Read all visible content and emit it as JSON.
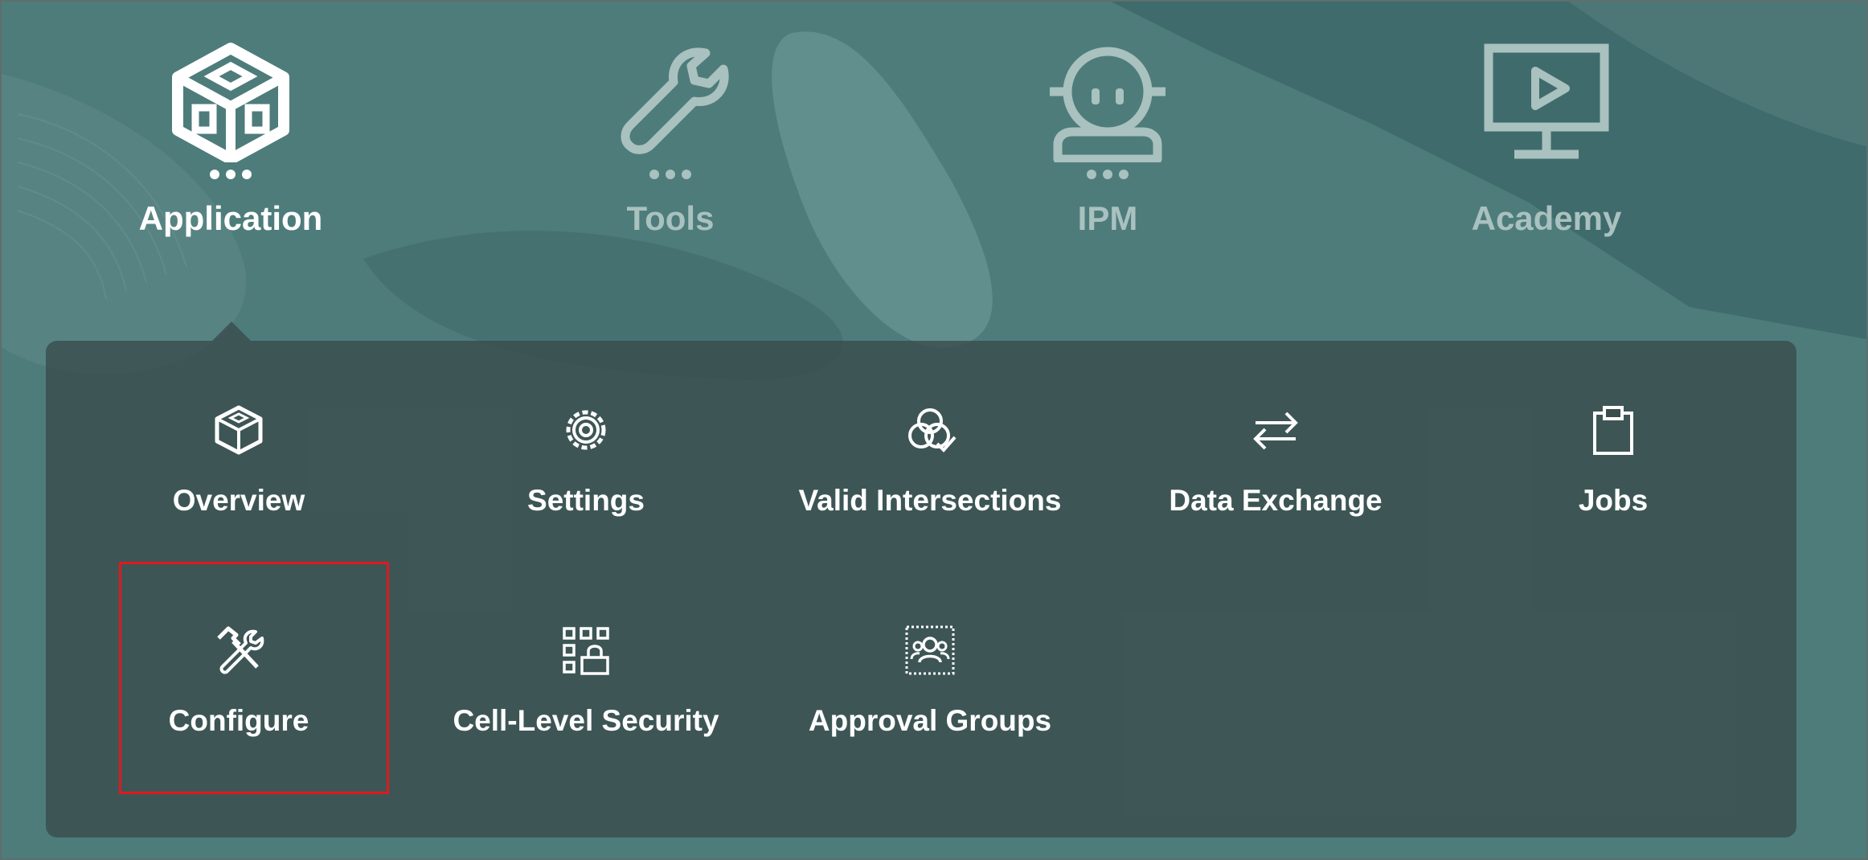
{
  "colors": {
    "background": "#4b7a79",
    "panel": "#3a4c4c",
    "active_text": "#ffffff",
    "inactive_text": "#a9c1bf",
    "highlight": "#e0191d"
  },
  "nav": {
    "items": [
      {
        "label": "Application",
        "icon": "application-cube-icon",
        "active": true
      },
      {
        "label": "Tools",
        "icon": "wrench-icon",
        "active": false
      },
      {
        "label": "IPM",
        "icon": "ipm-robot-icon",
        "active": false
      },
      {
        "label": "Academy",
        "icon": "monitor-play-icon",
        "active": false
      }
    ]
  },
  "panel": {
    "tiles": [
      {
        "label": "Overview",
        "icon": "cube-icon"
      },
      {
        "label": "Settings",
        "icon": "gear-icon"
      },
      {
        "label": "Valid Intersections",
        "icon": "intersections-check-icon"
      },
      {
        "label": "Data Exchange",
        "icon": "swap-arrows-icon"
      },
      {
        "label": "Jobs",
        "icon": "clipboard-icon"
      },
      {
        "label": "Configure",
        "icon": "hammer-wrench-icon"
      },
      {
        "label": "Cell-Level Security",
        "icon": "grid-lock-icon"
      },
      {
        "label": "Approval Groups",
        "icon": "group-users-icon"
      }
    ],
    "highlighted_tile": "Configure"
  }
}
